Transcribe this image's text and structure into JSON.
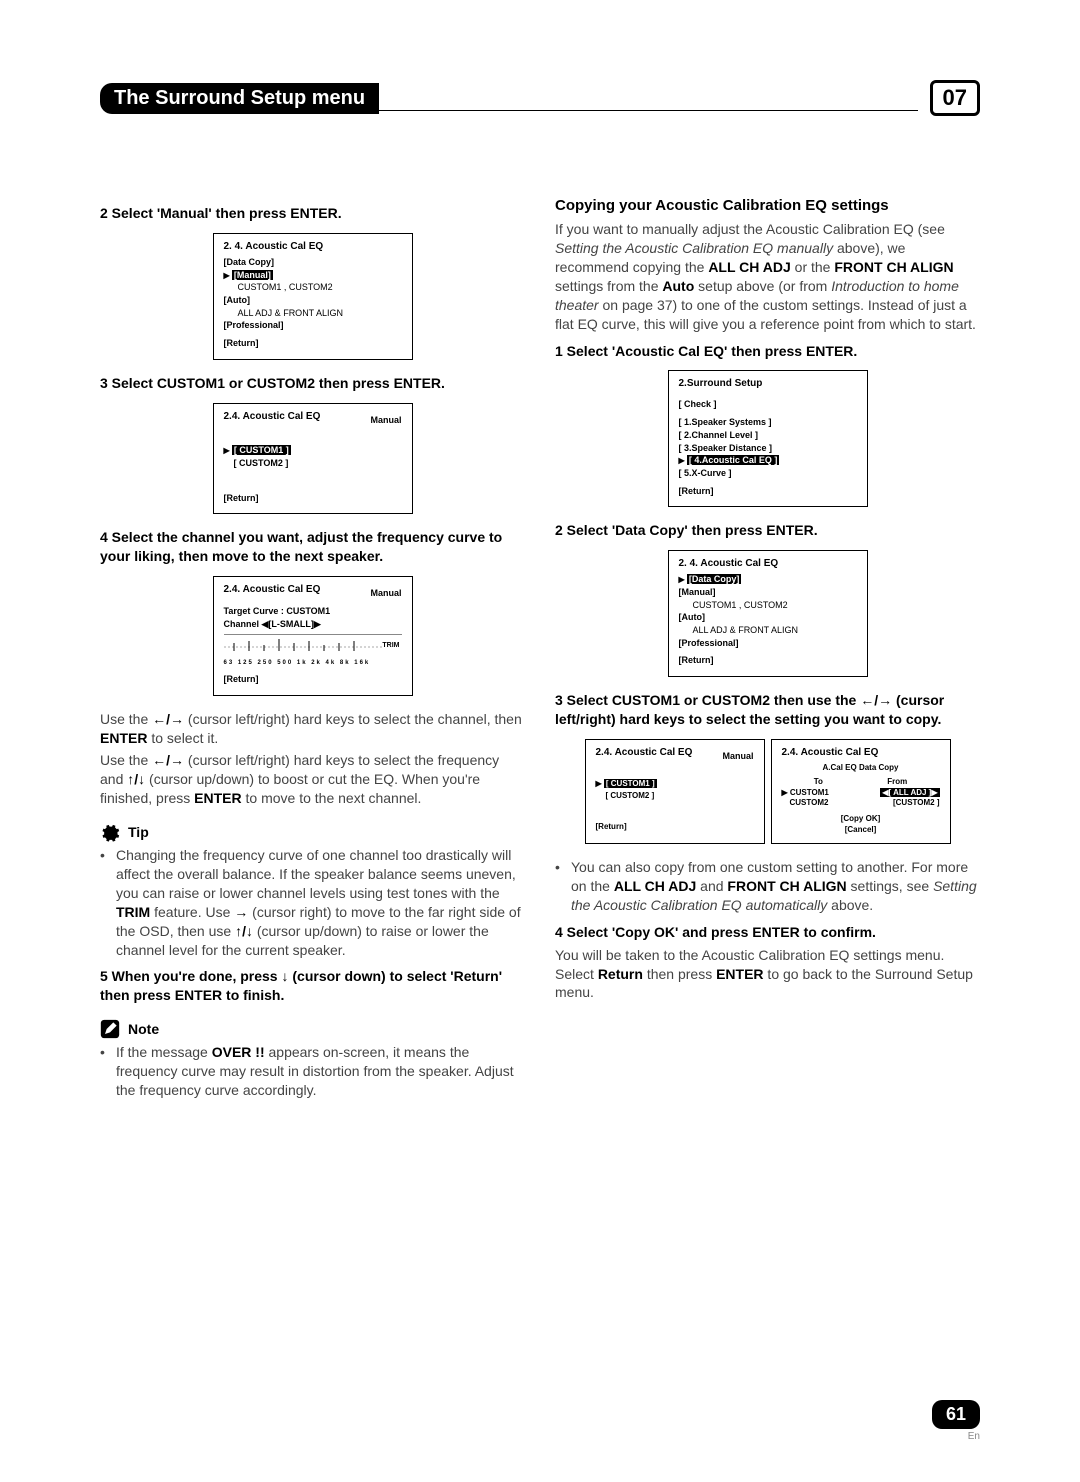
{
  "header": {
    "title": "The Surround Setup menu",
    "chapter": "07"
  },
  "left": {
    "step2": "2   Select 'Manual' then press ENTER.",
    "osd1": {
      "title": "2. 4. Acoustic  Cal  EQ",
      "rows": [
        "[Data Copy]",
        "[Manual]",
        "CUSTOM1 , CUSTOM2",
        "[Auto]",
        "ALL ADJ & FRONT ALIGN",
        "[Professional]",
        "[Return]"
      ],
      "hl_index": 1
    },
    "step3": "3   Select CUSTOM1 or CUSTOM2 then press ENTER.",
    "osd2": {
      "title": "2.4. Acoustic  Cal  EQ",
      "sub": "Manual",
      "rows": [
        "[ CUSTOM1 ]",
        "[ CUSTOM2 ]",
        "[Return]"
      ],
      "hl_index": 0
    },
    "step4": "4   Select the channel you want, adjust the frequency curve to your liking, then move to the next speaker.",
    "osd3": {
      "title": "2.4. Acoustic  Cal  EQ",
      "sub": "Manual",
      "target": "Target Curve : CUSTOM1",
      "channel": "Channel ◀[L-SMALL]▶",
      "trim": "TRIM",
      "ticks": "63 125 250 500 1k 2k 4k 8k 16k",
      "ret": "[Return]"
    },
    "p1a": "Use the ",
    "p1_arrows": "←/→",
    "p1b": " (cursor left/right) hard keys to select the channel, then ",
    "p1_enter": "ENTER",
    "p1c": " to select it.",
    "p2a": "Use the ",
    "p2_arrows1": "←/→",
    "p2b": " (cursor left/right) hard keys to select the frequency and ",
    "p2_arrows2": "↑/↓",
    "p2c": " (cursor up/down) to boost or cut the EQ. When you're finished, press ",
    "p2_enter": "ENTER",
    "p2d": " to move to the next channel.",
    "tip_label": "Tip",
    "tip_a": "Changing the frequency curve of one channel too drastically will affect the overall balance. If the speaker balance seems uneven, you can raise or lower channel levels using test tones with the ",
    "tip_trim": "TRIM",
    "tip_b": " feature. Use ",
    "tip_right": "→",
    "tip_c": " (cursor right) to move to the far right side of the OSD, then use ",
    "tip_updown": "↑/↓",
    "tip_d": " (cursor up/down) to raise or lower the channel level for the current speaker.",
    "step5a": "5   When you're done, press ",
    "step5_down": "↓",
    "step5b": " (cursor down) to select 'Return' then press ENTER to finish.",
    "note_label": "Note",
    "note_a": "If the message ",
    "note_over": "OVER !!",
    "note_b": " appears on-screen, it means the frequency curve may result in distortion from the speaker. Adjust the frequency curve accordingly."
  },
  "right": {
    "heading": "Copying your Acoustic Calibration EQ settings",
    "intro_a": "If you want to manually adjust the Acoustic Calibration EQ (see ",
    "intro_ref1": "Setting the Acoustic Calibration EQ manually",
    "intro_b": " above), we recommend copying the ",
    "intro_all": "ALL CH ADJ",
    "intro_c": " or the ",
    "intro_front": "FRONT CH ALIGN",
    "intro_d": " settings from the ",
    "intro_auto": "Auto",
    "intro_e": " setup above (or from ",
    "intro_ref2": "Introduction to home theater",
    "intro_f": " on page 37) to one of the custom settings. Instead of just a flat EQ curve, this will give you a reference point from which to start.",
    "step1": "1   Select 'Acoustic Cal EQ' then press ENTER.",
    "osd4": {
      "title": "2.Surround Setup",
      "rows": [
        "[ Check ]",
        "[ 1.Speaker Systems ]",
        "[ 2.Channel Level ]",
        "[ 3.Speaker Distance ]",
        "[ 4.Acoustic Cal EQ ]",
        "[ 5.X-Curve ]",
        "[Return]"
      ],
      "hl_index": 4
    },
    "step2r": "2   Select 'Data Copy' then press ENTER.",
    "osd5": {
      "title": "2. 4. Acoustic  Cal  EQ",
      "rows": [
        "[Data Copy]",
        "[Manual]",
        "CUSTOM1 , CUSTOM2",
        "[Auto]",
        "ALL ADJ & FRONT ALIGN",
        "[Professional]",
        "[Return]"
      ],
      "hl_index": 0
    },
    "step3ra": "3   Select CUSTOM1 or CUSTOM2 then use the ",
    "step3r_arrows": "←/→",
    "step3rb": " (cursor left/right) hard keys to select the setting you want to copy.",
    "osd6a": {
      "title": "2.4. Acoustic  Cal  EQ",
      "sub": "Manual",
      "rows": [
        "[ CUSTOM1 ]",
        "[ CUSTOM2 ]",
        "[Return]"
      ],
      "hl_index": 0
    },
    "osd6b": {
      "title": "2.4. Acoustic  Cal  EQ",
      "sub2": "A.Cal EQ Data Copy",
      "to": "To",
      "from": "From",
      "r1a": "▶ CUSTOM1",
      "r1b": "◀[ ALL ADJ ]▶",
      "r2a": "CUSTOM2",
      "r2b": "[CUSTOM2 ]",
      "copy": "[Copy OK]",
      "cancel": "[Cancel]"
    },
    "bullet_a": "You can also copy from one custom setting to another. For more on the ",
    "bul_all": "ALL CH ADJ",
    "bul_and": " and ",
    "bul_front": "FRONT CH ALIGN",
    "bul_b": " settings, see ",
    "bul_ref": "Setting the Acoustic Calibration EQ automatically",
    "bul_c": " above.",
    "step4r": "4   Select 'Copy OK' and press ENTER to confirm.",
    "p_end_a": "You will be taken to the Acoustic Calibration EQ settings menu. Select ",
    "p_end_ret": "Return",
    "p_end_b": " then press ",
    "p_end_enter": "ENTER",
    "p_end_c": " to go back to the Surround Setup menu."
  },
  "footer": {
    "page": "61",
    "lang": "En"
  }
}
